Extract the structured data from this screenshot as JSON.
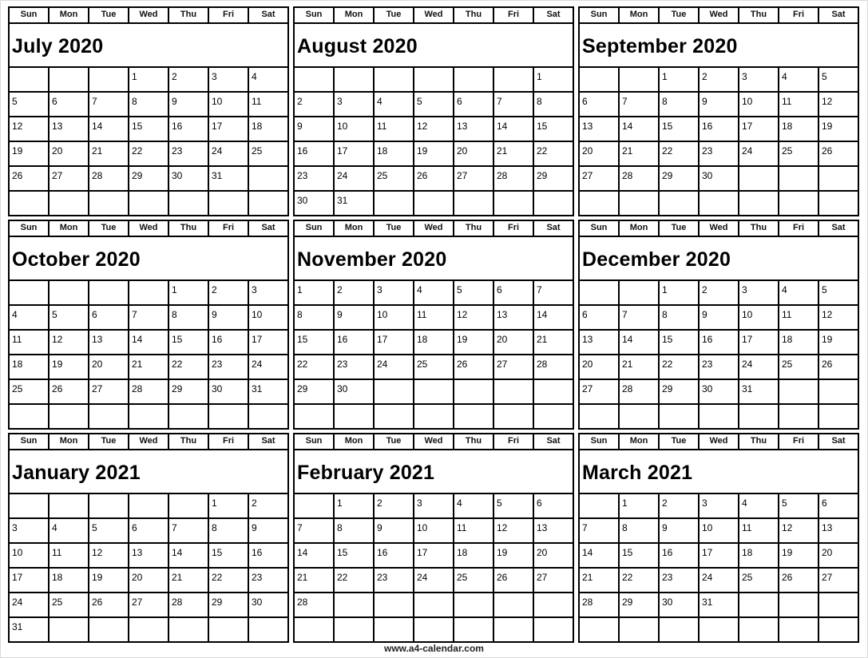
{
  "weekdays": [
    "Sun",
    "Mon",
    "Tue",
    "Wed",
    "Thu",
    "Fri",
    "Sat"
  ],
  "months": [
    {
      "title": "July 2020",
      "weeks": [
        [
          "",
          "",
          "",
          "1",
          "2",
          "3",
          "4"
        ],
        [
          "5",
          "6",
          "7",
          "8",
          "9",
          "10",
          "11"
        ],
        [
          "12",
          "13",
          "14",
          "15",
          "16",
          "17",
          "18"
        ],
        [
          "19",
          "20",
          "21",
          "22",
          "23",
          "24",
          "25"
        ],
        [
          "26",
          "27",
          "28",
          "29",
          "30",
          "31",
          ""
        ],
        [
          "",
          "",
          "",
          "",
          "",
          "",
          ""
        ]
      ]
    },
    {
      "title": "August 2020",
      "weeks": [
        [
          "",
          "",
          "",
          "",
          "",
          "",
          "1"
        ],
        [
          "2",
          "3",
          "4",
          "5",
          "6",
          "7",
          "8"
        ],
        [
          "9",
          "10",
          "11",
          "12",
          "13",
          "14",
          "15"
        ],
        [
          "16",
          "17",
          "18",
          "19",
          "20",
          "21",
          "22"
        ],
        [
          "23",
          "24",
          "25",
          "26",
          "27",
          "28",
          "29"
        ],
        [
          "30",
          "31",
          "",
          "",
          "",
          "",
          ""
        ]
      ]
    },
    {
      "title": "September 2020",
      "weeks": [
        [
          "",
          "",
          "1",
          "2",
          "3",
          "4",
          "5"
        ],
        [
          "6",
          "7",
          "8",
          "9",
          "10",
          "11",
          "12"
        ],
        [
          "13",
          "14",
          "15",
          "16",
          "17",
          "18",
          "19"
        ],
        [
          "20",
          "21",
          "22",
          "23",
          "24",
          "25",
          "26"
        ],
        [
          "27",
          "28",
          "29",
          "30",
          "",
          "",
          ""
        ],
        [
          "",
          "",
          "",
          "",
          "",
          "",
          ""
        ]
      ]
    },
    {
      "title": "October 2020",
      "weeks": [
        [
          "",
          "",
          "",
          "",
          "1",
          "2",
          "3"
        ],
        [
          "4",
          "5",
          "6",
          "7",
          "8",
          "9",
          "10"
        ],
        [
          "11",
          "12",
          "13",
          "14",
          "15",
          "16",
          "17"
        ],
        [
          "18",
          "19",
          "20",
          "21",
          "22",
          "23",
          "24"
        ],
        [
          "25",
          "26",
          "27",
          "28",
          "29",
          "30",
          "31"
        ],
        [
          "",
          "",
          "",
          "",
          "",
          "",
          ""
        ]
      ]
    },
    {
      "title": "November 2020",
      "weeks": [
        [
          "1",
          "2",
          "3",
          "4",
          "5",
          "6",
          "7"
        ],
        [
          "8",
          "9",
          "10",
          "11",
          "12",
          "13",
          "14"
        ],
        [
          "15",
          "16",
          "17",
          "18",
          "19",
          "20",
          "21"
        ],
        [
          "22",
          "23",
          "24",
          "25",
          "26",
          "27",
          "28"
        ],
        [
          "29",
          "30",
          "",
          "",
          "",
          "",
          ""
        ],
        [
          "",
          "",
          "",
          "",
          "",
          "",
          ""
        ]
      ]
    },
    {
      "title": "December 2020",
      "weeks": [
        [
          "",
          "",
          "1",
          "2",
          "3",
          "4",
          "5"
        ],
        [
          "6",
          "7",
          "8",
          "9",
          "10",
          "11",
          "12"
        ],
        [
          "13",
          "14",
          "15",
          "16",
          "17",
          "18",
          "19"
        ],
        [
          "20",
          "21",
          "22",
          "23",
          "24",
          "25",
          "26"
        ],
        [
          "27",
          "28",
          "29",
          "30",
          "31",
          "",
          ""
        ],
        [
          "",
          "",
          "",
          "",
          "",
          "",
          ""
        ]
      ]
    },
    {
      "title": "January 2021",
      "weeks": [
        [
          "",
          "",
          "",
          "",
          "",
          "1",
          "2"
        ],
        [
          "3",
          "4",
          "5",
          "6",
          "7",
          "8",
          "9"
        ],
        [
          "10",
          "11",
          "12",
          "13",
          "14",
          "15",
          "16"
        ],
        [
          "17",
          "18",
          "19",
          "20",
          "21",
          "22",
          "23"
        ],
        [
          "24",
          "25",
          "26",
          "27",
          "28",
          "29",
          "30"
        ],
        [
          "31",
          "",
          "",
          "",
          "",
          "",
          ""
        ]
      ]
    },
    {
      "title": "February 2021",
      "weeks": [
        [
          "",
          "1",
          "2",
          "3",
          "4",
          "5",
          "6"
        ],
        [
          "7",
          "8",
          "9",
          "10",
          "11",
          "12",
          "13"
        ],
        [
          "14",
          "15",
          "16",
          "17",
          "18",
          "19",
          "20"
        ],
        [
          "21",
          "22",
          "23",
          "24",
          "25",
          "26",
          "27"
        ],
        [
          "28",
          "",
          "",
          "",
          "",
          "",
          ""
        ],
        [
          "",
          "",
          "",
          "",
          "",
          "",
          ""
        ]
      ]
    },
    {
      "title": "March 2021",
      "weeks": [
        [
          "",
          "1",
          "2",
          "3",
          "4",
          "5",
          "6"
        ],
        [
          "7",
          "8",
          "9",
          "10",
          "11",
          "12",
          "13"
        ],
        [
          "14",
          "15",
          "16",
          "17",
          "18",
          "19",
          "20"
        ],
        [
          "21",
          "22",
          "23",
          "24",
          "25",
          "26",
          "27"
        ],
        [
          "28",
          "29",
          "30",
          "31",
          "",
          "",
          ""
        ],
        [
          "",
          "",
          "",
          "",
          "",
          "",
          ""
        ]
      ]
    }
  ],
  "footer": {
    "website": "www.a4-calendar.com"
  }
}
